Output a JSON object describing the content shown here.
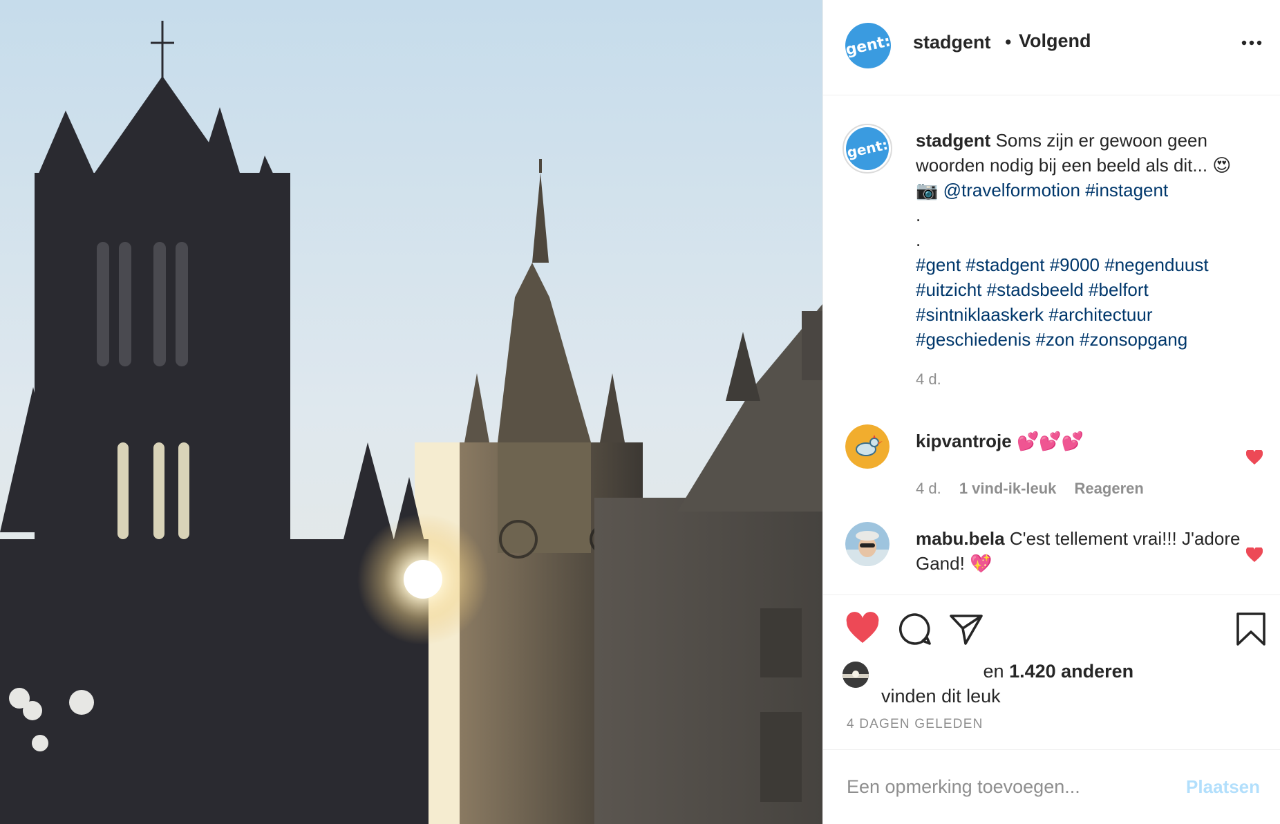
{
  "header": {
    "avatar_text": "gent:",
    "username": "stadgent",
    "dot": "•",
    "follow_label": "Volgend",
    "more_icon": "ellipsis-icon"
  },
  "caption": {
    "avatar_text": "gent:",
    "username": "stadgent",
    "text_line1": "Soms zijn er gewoon geen",
    "text_line2": "woorden nodig bij een beeld als dit... 😍",
    "camera": "📷",
    "mention": "@travelformotion",
    "tag_instagent": "#instagent",
    "dot1": ".",
    "dot2": ".",
    "hashtags_line1": "#gent #stadgent #9000 #negenduust",
    "hashtags_line2": "#uitzicht #stadsbeeld #belfort",
    "hashtags_line3": "#sintniklaaskerk #architectuur",
    "hashtags_line4": "#geschiedenis #zon #zonsopgang",
    "time": "4 d."
  },
  "comments": [
    {
      "username": "kipvantroje",
      "text": "💕💕💕",
      "time": "4 d.",
      "likes": "1 vind-ik-leuk",
      "reply": "Reageren"
    },
    {
      "username": "mabu.bela",
      "text": "C'est tellement vrai!!! J'adore Gand! 💖"
    }
  ],
  "actions": {
    "like_icon": "heart-filled-icon",
    "comment_icon": "comment-bubble-icon",
    "share_icon": "paper-plane-icon",
    "save_icon": "bookmark-icon",
    "likes_mid": "en",
    "likes_count": "1.420 anderen",
    "likes_end": "vinden dit leuk",
    "date": "4 DAGEN GELEDEN"
  },
  "add_comment": {
    "placeholder": "Een opmerking toevoegen...",
    "post_label": "Plaatsen"
  },
  "colors": {
    "like_red": "#ed4956",
    "link_blue": "#00376b",
    "meta_gray": "#8e8e8e",
    "brand_blue": "#3a9be0",
    "post_disabled": "#b2dffc"
  }
}
